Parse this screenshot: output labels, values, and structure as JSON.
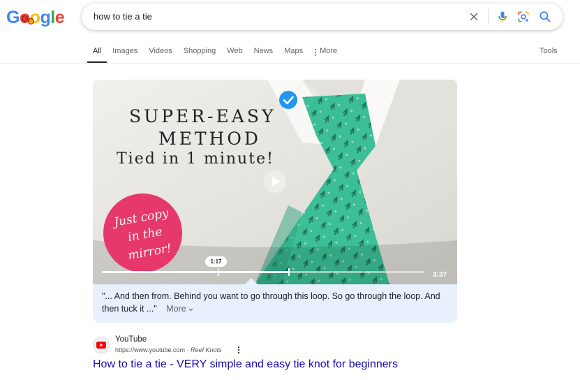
{
  "logo": {
    "text": [
      "G",
      "o",
      "o",
      "g",
      "l",
      "e"
    ],
    "colors": [
      "#4285f4",
      "#ea4335",
      "#fbbc05",
      "#4285f4",
      "#34a853",
      "#ea4335"
    ]
  },
  "search": {
    "query": "how to tie a tie",
    "clear_icon": "close-icon",
    "voice_icon": "microphone-icon",
    "lens_icon": "camera-lens-icon",
    "submit_icon": "magnifier-icon"
  },
  "tabs": [
    {
      "label": "All",
      "active": true
    },
    {
      "label": "Images"
    },
    {
      "label": "Videos"
    },
    {
      "label": "Shopping"
    },
    {
      "label": "Web"
    },
    {
      "label": "News"
    },
    {
      "label": "Maps"
    },
    {
      "label": "More",
      "icon": "vertical-dots-icon"
    }
  ],
  "tools_label": "Tools",
  "video": {
    "headline_1": "SUPER-EASY",
    "headline_2": "METHOD",
    "headline_3": "Tied in 1 minute!",
    "badge_lines": [
      "Just copy",
      "in the",
      "mirror!"
    ],
    "current_time": "1:17",
    "duration": "3:37",
    "progress_fraction": 0.36,
    "key_moment_fraction": 0.58,
    "verified_icon": "checkmark-badge-icon",
    "play_icon": "play-icon"
  },
  "transcript": {
    "text": "\"... And then from. Behind you want to go through this loop. So go through the loop. And then tuck it ...\"",
    "more_label": "More"
  },
  "result": {
    "site_name": "YouTube",
    "url": "https://www.youtube.com",
    "separator": " · ",
    "channel": "Reef Knots",
    "title": "How to tie a tie - VERY simple and easy tie knot for beginners"
  },
  "colors": {
    "link": "#1a0dab",
    "accent_blue": "#1a73e8",
    "tie_green": "#3cbf96",
    "badge_pink": "#e7386b",
    "transcript_bg": "#e8f0fe"
  }
}
